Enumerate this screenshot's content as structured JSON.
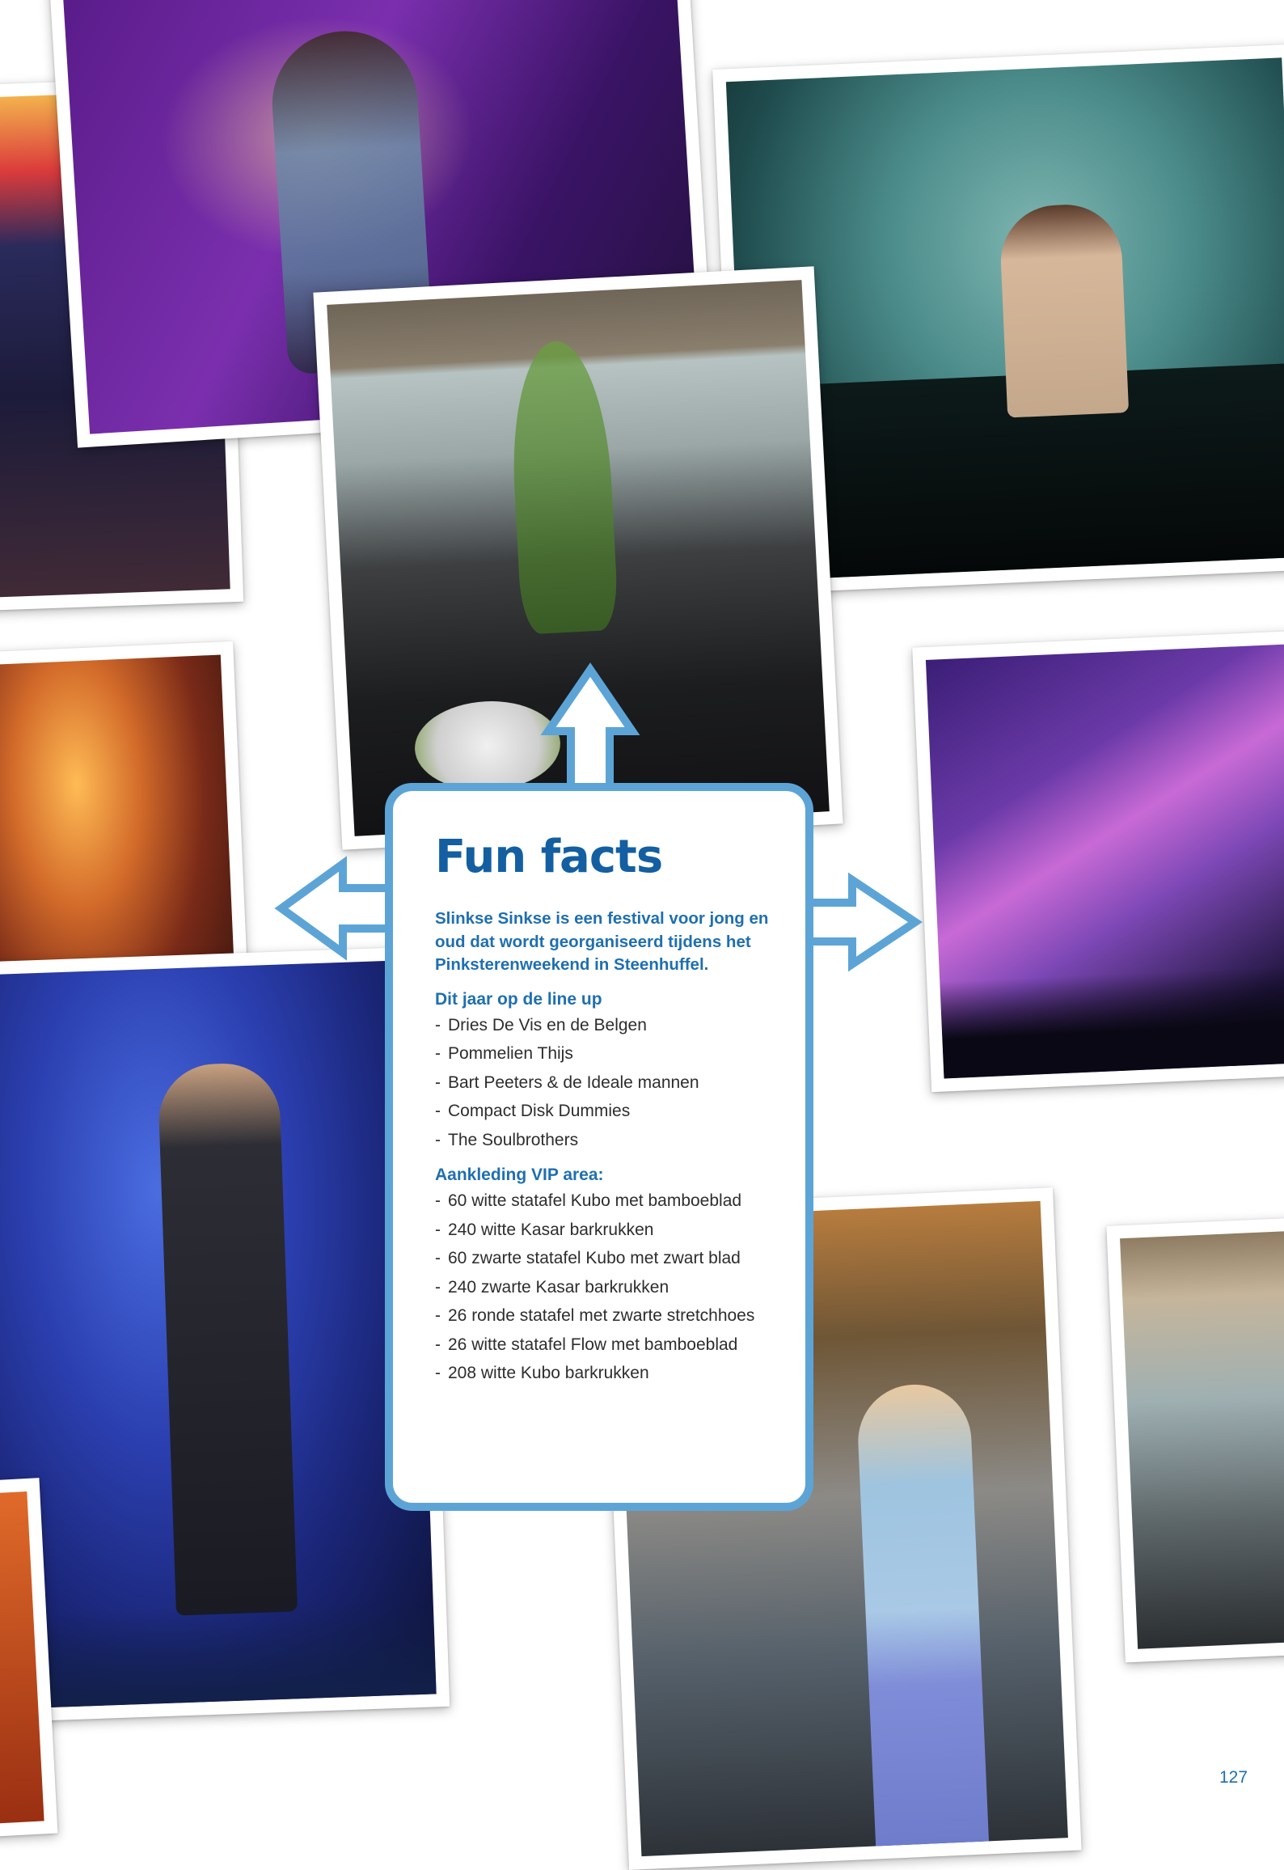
{
  "fun_facts": {
    "title": "Fun facts",
    "intro": "Slinkse Sinkse is een festival voor jong en oud dat wordt georganiseerd tijdens het Pinksterenweekend in Steenhuffel.",
    "lineup": {
      "heading": "Dit jaar op de line up",
      "items": [
        "Dries De Vis en de Belgen",
        "Pommelien Thijs",
        "Bart Peeters & de Ideale mannen",
        "Compact Disk Dummies",
        "The Soulbrothers"
      ]
    },
    "vip": {
      "heading": "Aankleding VIP area:",
      "items": [
        "60 witte statafel Kubo met bamboeblad",
        "240 witte Kasar barkrukken",
        "60 zwarte statafel Kubo met zwart blad",
        "240 zwarte Kasar barkrukken",
        "26 ronde statafel met zwarte stretchhoes",
        "26 witte statafel Flow met bamboeblad",
        "208 witte Kubo barkrukken"
      ]
    }
  },
  "page_number": "127",
  "colors": {
    "accent_blue": "#135fa1",
    "frame_blue": "#5da4d6"
  }
}
